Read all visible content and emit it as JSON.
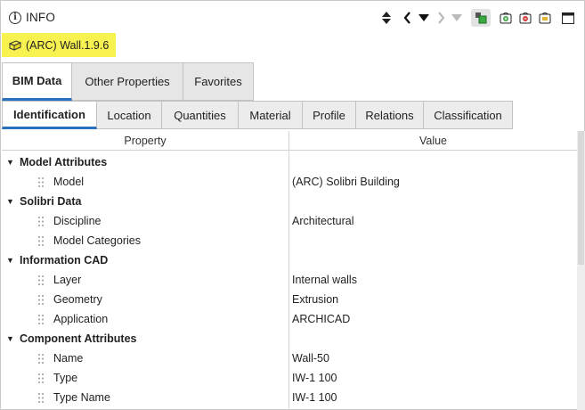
{
  "header": {
    "title": "INFO",
    "icons": [
      "info-icon",
      "sort-updown-icon",
      "nav-prev-icon",
      "nav-dropdown-icon",
      "nav-next-icon",
      "nav-menu-icon",
      "filter-objects-icon",
      "add-to-basket-icon",
      "remove-from-basket-icon",
      "basket-icon",
      "maximize-icon"
    ]
  },
  "selection": {
    "label": "(ARC) Wall.1.9.6",
    "icon": "wall-icon",
    "highlight_color": "#f7f250"
  },
  "top_tabs": [
    {
      "label": "BIM Data",
      "active": true
    },
    {
      "label": "Other Properties",
      "active": false
    },
    {
      "label": "Favorites",
      "active": false
    }
  ],
  "sub_tabs": [
    {
      "label": "Identification",
      "active": true
    },
    {
      "label": "Location",
      "active": false
    },
    {
      "label": "Quantities",
      "active": false
    },
    {
      "label": "Material",
      "active": false
    },
    {
      "label": "Profile",
      "active": false
    },
    {
      "label": "Relations",
      "active": false
    },
    {
      "label": "Classification",
      "active": false
    }
  ],
  "table": {
    "columns": [
      "Property",
      "Value"
    ],
    "rows": [
      {
        "type": "group",
        "label": "Model Attributes",
        "value": ""
      },
      {
        "type": "item",
        "label": "Model",
        "value": "(ARC) Solibri Building"
      },
      {
        "type": "group",
        "label": "Solibri Data",
        "value": ""
      },
      {
        "type": "item",
        "label": "Discipline",
        "value": "Architectural"
      },
      {
        "type": "item",
        "label": "Model Categories",
        "value": ""
      },
      {
        "type": "group",
        "label": "Information CAD",
        "value": ""
      },
      {
        "type": "item",
        "label": "Layer",
        "value": "Internal walls"
      },
      {
        "type": "item",
        "label": "Geometry",
        "value": "Extrusion"
      },
      {
        "type": "item",
        "label": "Application",
        "value": "ARCHICAD"
      },
      {
        "type": "group",
        "label": "Component Attributes",
        "value": ""
      },
      {
        "type": "item",
        "label": "Name",
        "value": "Wall-50"
      },
      {
        "type": "item",
        "label": "Type",
        "value": "IW-1 100"
      },
      {
        "type": "item",
        "label": "Type Name",
        "value": "IW-1 100"
      }
    ]
  },
  "colors": {
    "accent": "#2a70c0",
    "tab_inactive": "#e6e6e6",
    "basket_green": "#3aa843"
  }
}
